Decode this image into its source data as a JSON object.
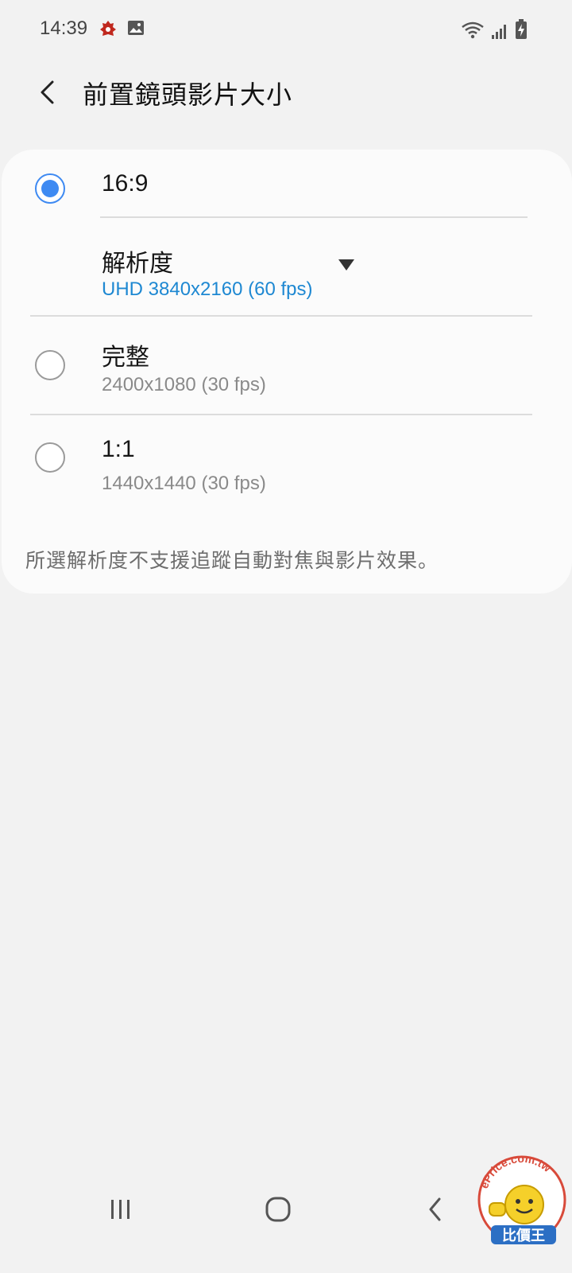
{
  "status_bar": {
    "time": "14:39",
    "icons_left": [
      "app-icon",
      "gallery-icon"
    ],
    "icons_right": [
      "wifi-icon",
      "signal-icon",
      "battery-charging-icon"
    ]
  },
  "app_bar": {
    "title": "前置鏡頭影片大小",
    "back_icon": "back-arrow-icon"
  },
  "options": [
    {
      "label": "16:9",
      "selected": true,
      "resolution_label": "解析度",
      "resolution_value": "UHD 3840x2160 (60 fps)"
    },
    {
      "label": "完整",
      "sub": "2400x1080 (30 fps)",
      "selected": false
    },
    {
      "label": "1:1",
      "sub": "1440x1440 (30 fps)",
      "selected": false
    }
  ],
  "note": "所選解析度不支援追蹤自動對焦與影片效果。",
  "nav_bar": [
    "recents-icon",
    "home-icon",
    "back-icon"
  ],
  "colors": {
    "accent": "#3e8af2",
    "resolution_link": "#1e88d2",
    "background": "#f2f2f2",
    "card": "#fbfbfb"
  },
  "watermark": {
    "text_top": "ePrice.com.tw",
    "text_bottom": "比價王"
  }
}
